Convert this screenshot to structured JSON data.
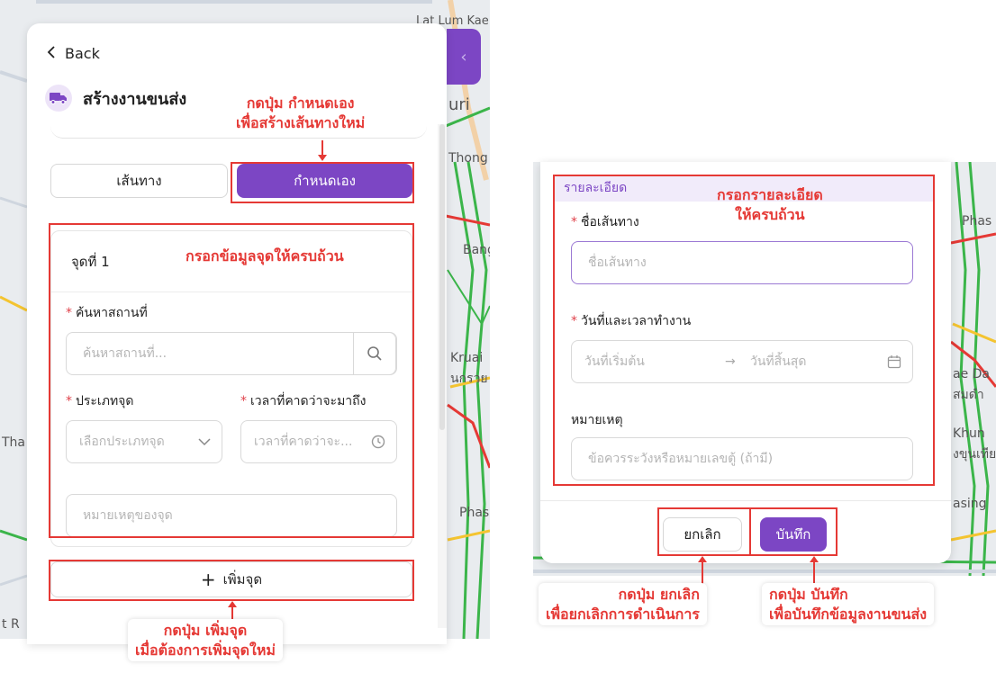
{
  "colors": {
    "accent": "#7c46c4",
    "annotation": "#e53935",
    "required": "#e0424b"
  },
  "left_panel": {
    "back_label": "Back",
    "title": "สร้างงานขนส่ง",
    "title_icon": "truck-icon",
    "tabs": {
      "route_label": "เส้นทาง",
      "custom_label": "กำหนดเอง",
      "active": "กำหนดเอง"
    },
    "point": {
      "heading": "จุดที่ 1",
      "search_label": "ค้นหาสถานที่",
      "search_placeholder": "ค้นหาสถานที่...",
      "type_label": "ประเภทจุด",
      "type_placeholder": "เลือกประเภทจุด",
      "eta_label": "เวลาที่คาดว่าจะมาถึง",
      "eta_placeholder": "เวลาที่คาดว่าจะ...",
      "note_placeholder": "หมายเหตุของจุด"
    },
    "add_point_label": "เพิ่มจุด"
  },
  "right_panel": {
    "section_title": "รายละเอียด",
    "route_name_label": "ชื่อเส้นทาง",
    "route_name_placeholder": "ชื่อเส้นทาง",
    "datetime_label": "วันที่และเวลาทำงาน",
    "start_placeholder": "วันที่เริ่มต้น",
    "end_placeholder": "วันที่สิ้นสุด",
    "note_label": "หมายเหตุ",
    "note_placeholder": "ข้อควรระวังหรือหมายเลขตู้ (ถ้ามี)",
    "cancel_label": "ยกเลิก",
    "save_label": "บันทึก"
  },
  "annotations": {
    "custom_line1": "กดปุ่ม กำหนดเอง",
    "custom_line2": "เพื่อสร้างเส้นทางใหม่",
    "point_fill": "กรอกข้อมูลจุดให้ครบถ้วน",
    "add_line1": "กดปุ่ม เพิ่มจุด",
    "add_line2": "เมื่อต้องการเพิ่มจุดใหม่",
    "details_line1": "กรอกรายละเอียด",
    "details_line2": "ให้ครบถ้วน",
    "cancel_line1": "กดปุ่ม ยกเลิก",
    "cancel_line2": "เพื่อยกเลิกการดำเนินการ",
    "save_line1": "กดปุ่ม บันทึก",
    "save_line2": "เพื่อบันทึกข้อมูลงานขนส่ง"
  },
  "map_labels": {
    "left": [
      "Lat Lum Kae",
      "uri",
      "Thong",
      "Bang",
      "Kruai",
      "นกรวย",
      "Phas",
      "Tha",
      "t R"
    ],
    "right": [
      "Phas",
      "ae Da",
      "สมดำ",
      "Khun",
      "งขุนเทีย",
      "asing"
    ]
  }
}
